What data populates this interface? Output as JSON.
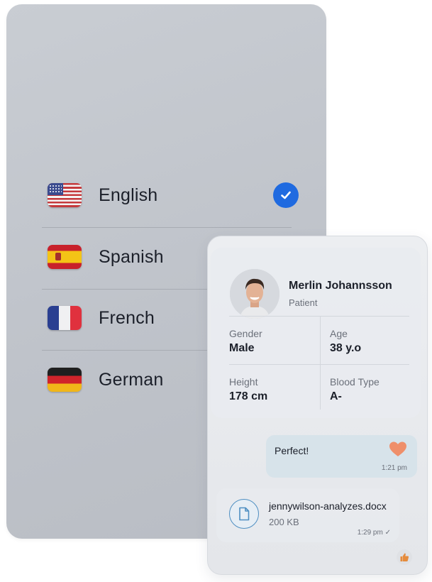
{
  "languages": {
    "items": [
      {
        "label": "English",
        "flag": "us-flag-icon",
        "selected": true
      },
      {
        "label": "Spanish",
        "flag": "spain-flag-icon",
        "selected": false
      },
      {
        "label": "French",
        "flag": "france-flag-icon",
        "selected": false
      },
      {
        "label": "German",
        "flag": "germany-flag-icon",
        "selected": false
      }
    ],
    "selected_icon": "check-circle-icon",
    "accent": "#1f6ae0"
  },
  "patient": {
    "name": "Merlin Johannsson",
    "role": "Patient",
    "stats": {
      "gender": {
        "label": "Gender",
        "value": "Male"
      },
      "age": {
        "label": "Age",
        "value": "38 y.o"
      },
      "height": {
        "label": "Height",
        "value": "178 cm"
      },
      "blood": {
        "label": "Blood Type",
        "value": "A-"
      }
    }
  },
  "chat": {
    "message": {
      "text": "Perfect!",
      "time": "1:21 pm",
      "reaction": "heart-icon"
    },
    "file": {
      "name": "jennywilson-analyzes.docx",
      "size": "200 KB",
      "time": "1:29 pm",
      "status": "✓"
    },
    "reaction_button": "thumbs-up-icon"
  }
}
